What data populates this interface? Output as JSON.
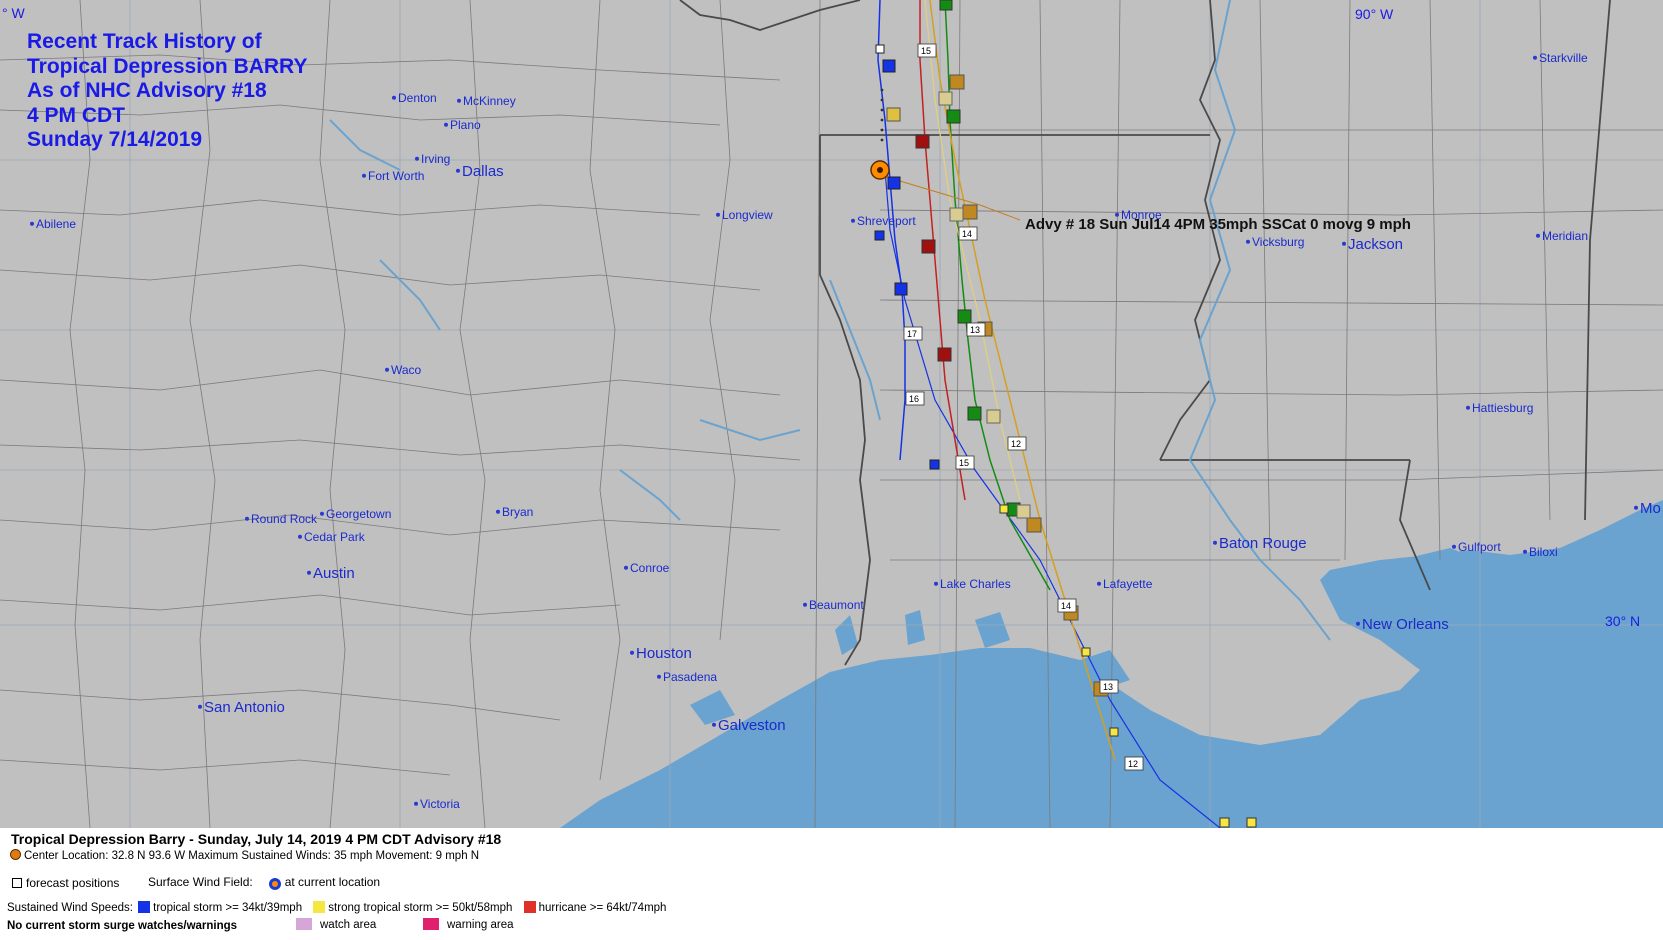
{
  "map": {
    "title_lines": [
      "Recent Track History of",
      "Tropical Depression BARRY",
      "As of NHC Advisory #18",
      "4 PM CDT",
      "Sunday 7/14/2019"
    ],
    "grid_labels": {
      "lon_left": "° W",
      "lon_90": "90° W",
      "lat_30": "30° N"
    },
    "advisory_annotation": "Advy # 18 Sun Jul14 4PM  35mph SSCat 0 movg 9 mph",
    "cities": [
      {
        "name": "Denton"
      },
      {
        "name": "McKinney"
      },
      {
        "name": "Plano"
      },
      {
        "name": "Irving"
      },
      {
        "name": "Fort Worth"
      },
      {
        "name": "Dallas"
      },
      {
        "name": "Abilene"
      },
      {
        "name": "Longview"
      },
      {
        "name": "Shreveport"
      },
      {
        "name": "Monroe"
      },
      {
        "name": "Vicksburg"
      },
      {
        "name": "Jackson"
      },
      {
        "name": "Meridian"
      },
      {
        "name": "Starkville"
      },
      {
        "name": "Waco"
      },
      {
        "name": "Hattiesburg"
      },
      {
        "name": "Round Rock"
      },
      {
        "name": "Georgetown"
      },
      {
        "name": "Cedar Park"
      },
      {
        "name": "Bryan"
      },
      {
        "name": "Austin"
      },
      {
        "name": "Conroe"
      },
      {
        "name": "Baton Rouge"
      },
      {
        "name": "Gulfport"
      },
      {
        "name": "Biloxi"
      },
      {
        "name": "Mo"
      },
      {
        "name": "Lake Charles"
      },
      {
        "name": "Lafayette"
      },
      {
        "name": "Beaumont"
      },
      {
        "name": "New Orleans"
      },
      {
        "name": "Houston"
      },
      {
        "name": "Pasadena"
      },
      {
        "name": "San Antonio"
      },
      {
        "name": "Galveston"
      },
      {
        "name": "Victoria"
      }
    ],
    "forecast_labels": [
      "15",
      "14",
      "13",
      "17",
      "16",
      "15",
      "12",
      "14",
      "13",
      "12"
    ],
    "colors": {
      "land": "#c0c0c0",
      "water": "#6aa3cf",
      "border": "#888888",
      "state_line": "#555555",
      "tropical_storm": "#1432e6",
      "strong_ts": "#f5e642",
      "hurricane": "#e0302a"
    }
  },
  "legend": {
    "header": "Tropical Depression Barry  -  Sunday, July 14, 2019  4 PM CDT   Advisory #18",
    "center_info": "Center Location: 32.8 N  93.6 W   Maximum Sustained Winds: 35 mph  Movement: 9 mph N",
    "forecast_positions": "forecast positions",
    "surface_wind_field": "Surface Wind Field:",
    "at_current_location": "at current location",
    "sustained_label": "Sustained Wind Speeds:",
    "tropical_storm": "tropical storm >= 34kt/39mph",
    "strong_ts": "strong tropical storm >= 50kt/58mph",
    "hurricane": "hurricane >= 64kt/74mph",
    "surge_note": "No current storm surge watches/warnings",
    "watch_area": "watch area",
    "warning_area": "warning area",
    "watch_color": "#d6a6d6",
    "warning_color": "#e0206e"
  }
}
